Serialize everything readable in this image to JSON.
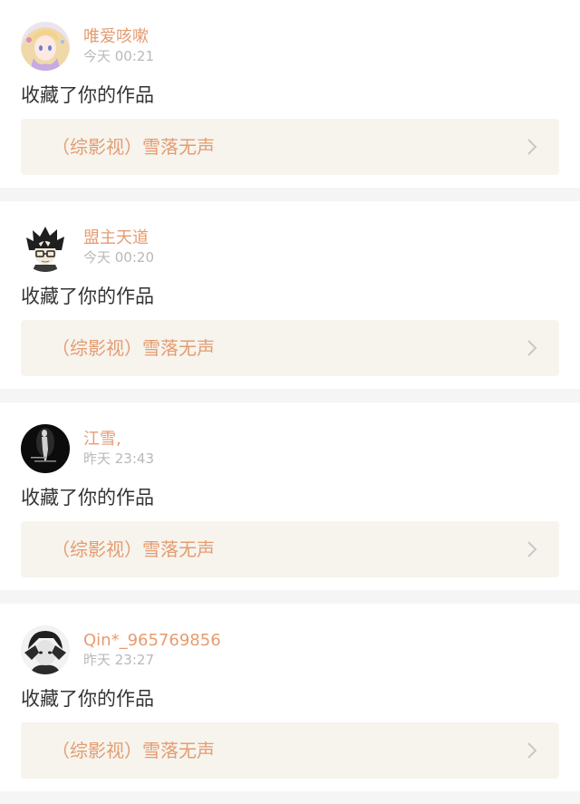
{
  "colors": {
    "username": "#e59c71",
    "work_title": "#e59c71",
    "timestamp": "#b9b9b9",
    "action_text": "#333333",
    "link_background": "#f6f4ed",
    "divider": "#f5f5f5",
    "chevron": "#c8c8c8"
  },
  "notifications": [
    {
      "username": "唯爱咳嗽",
      "time": "今天 00:21",
      "action": "收藏了你的作品",
      "work_title": "（综影视）雪落无声",
      "avatar_icon": "anime-girl-avatar",
      "chevron_icon": "chevron-right-icon"
    },
    {
      "username": "盟主天道",
      "time": "今天 00:20",
      "action": "收藏了你的作品",
      "work_title": "（综影视）雪落无声",
      "avatar_icon": "anime-boy-glasses-avatar",
      "chevron_icon": "chevron-right-icon"
    },
    {
      "username": "江雪,",
      "time": "昨天 23:43",
      "action": "收藏了你的作品",
      "work_title": "（综影视）雪落无声",
      "avatar_icon": "dark-figure-avatar",
      "chevron_icon": "chevron-right-icon"
    },
    {
      "username": "Qin*_965769856",
      "time": "昨天 23:27",
      "action": "收藏了你的作品",
      "work_title": "（综影视）雪落无声",
      "avatar_icon": "monochrome-portrait-avatar",
      "chevron_icon": "chevron-right-icon"
    }
  ]
}
